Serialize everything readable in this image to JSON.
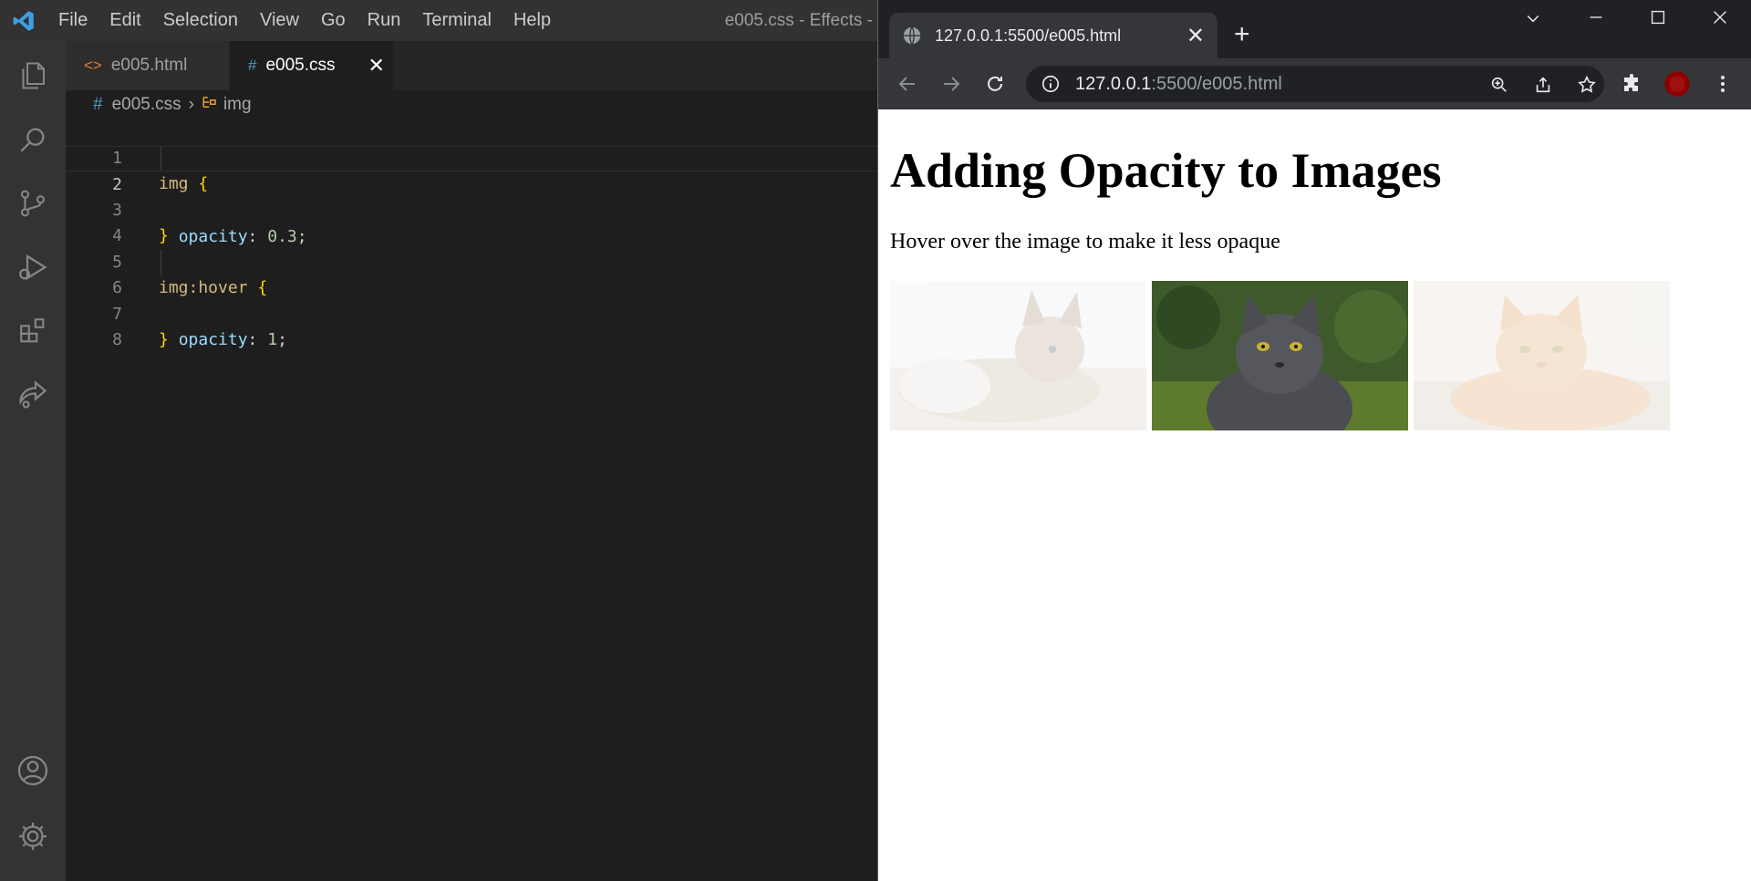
{
  "vscode": {
    "menu": [
      "File",
      "Edit",
      "Selection",
      "View",
      "Go",
      "Run",
      "Terminal",
      "Help"
    ],
    "window_title": "e005.css - Effects -",
    "tabs": [
      {
        "label": "e005.html",
        "icon": "html-file-icon"
      },
      {
        "label": "e005.css",
        "icon": "css-file-icon",
        "close": "✕"
      }
    ],
    "breadcrumb": {
      "hash": "#",
      "file": "e005.css",
      "symbol": "img"
    },
    "lines": [
      {
        "n": "1",
        "a": "img",
        "b": " {",
        "c": "",
        "d": "",
        "e": ""
      },
      {
        "n": "2",
        "a": "",
        "b": "",
        "c": "opacity",
        "d": "0.3",
        "e": ";"
      },
      {
        "n": "3",
        "a": "",
        "b": "}",
        "c": "",
        "d": "",
        "e": ""
      },
      {
        "n": "4",
        "a": "",
        "b": "",
        "c": "",
        "d": "",
        "e": ""
      },
      {
        "n": "5",
        "a": "img:hover",
        "b": " {",
        "c": "",
        "d": "",
        "e": ""
      },
      {
        "n": "6",
        "a": "",
        "b": "",
        "c": "opacity",
        "d": "1",
        "e": ";"
      },
      {
        "n": "7",
        "a": "",
        "b": "}",
        "c": "",
        "d": "",
        "e": ""
      },
      {
        "n": "8",
        "a": "",
        "b": "",
        "c": "",
        "d": "",
        "e": ""
      }
    ]
  },
  "browser": {
    "tab_title": "127.0.0.1:5500/e005.html",
    "tab_close": "✕",
    "new_tab": "+",
    "url_host": "127.0.0.1",
    "url_rest": ":5500/e005.html",
    "page": {
      "heading": "Adding Opacity to Images",
      "paragraph": "Hover over the image to make it less opaque",
      "images": [
        {
          "name": "cat-image-1",
          "opacity": 0.3
        },
        {
          "name": "cat-image-2",
          "opacity": 1
        },
        {
          "name": "cat-image-3",
          "opacity": 0.3
        }
      ]
    }
  },
  "colors": {
    "accent": "#007acc",
    "profile": "#8b0000"
  }
}
